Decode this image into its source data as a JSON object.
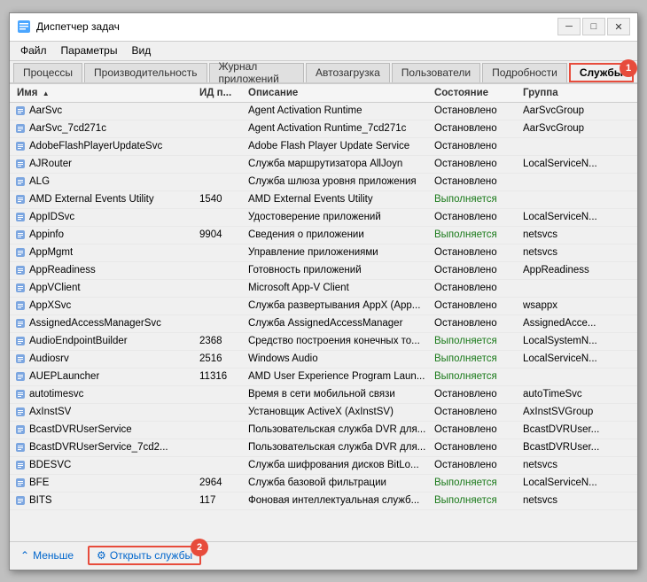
{
  "window": {
    "title": "Диспетчер задач",
    "icon": "⚙"
  },
  "menu": {
    "items": [
      "Файл",
      "Параметры",
      "Вид"
    ]
  },
  "tabs": {
    "items": [
      "Процессы",
      "Производительность",
      "Журнал приложений",
      "Автозагрузка",
      "Пользователи",
      "Подробности",
      "Службы"
    ],
    "active": 6
  },
  "table": {
    "headers": {
      "name": "Имя",
      "pid": "ИД п...",
      "description": "Описание",
      "status": "Состояние",
      "group": "Группа"
    },
    "rows": [
      {
        "name": "AarSvc",
        "pid": "",
        "description": "Agent Activation Runtime",
        "status": "Остановлено",
        "group": "AarSvcGroup",
        "icon": "⚙",
        "running": false
      },
      {
        "name": "AarSvc_7cd271c",
        "pid": "",
        "description": "Agent Activation Runtime_7cd271c",
        "status": "Остановлено",
        "group": "AarSvcGroup",
        "icon": "⚙",
        "running": false
      },
      {
        "name": "AdobeFlashPlayerUpdateSvc",
        "pid": "",
        "description": "Adobe Flash Player Update Service",
        "status": "Остановлено",
        "group": "",
        "icon": "⚙",
        "running": false
      },
      {
        "name": "AJRouter",
        "pid": "",
        "description": "Служба маршрутизатора AllJoyn",
        "status": "Остановлено",
        "group": "LocalServiceN...",
        "icon": "⚙",
        "running": false
      },
      {
        "name": "ALG",
        "pid": "",
        "description": "Служба шлюза уровня приложения",
        "status": "Остановлено",
        "group": "",
        "icon": "⚙",
        "running": false
      },
      {
        "name": "AMD External Events Utility",
        "pid": "1540",
        "description": "AMD External Events Utility",
        "status": "Выполняется",
        "group": "",
        "icon": "⚙",
        "running": true
      },
      {
        "name": "AppIDSvc",
        "pid": "",
        "description": "Удостоверение приложений",
        "status": "Остановлено",
        "group": "LocalServiceN...",
        "icon": "⚙",
        "running": false
      },
      {
        "name": "Appinfo",
        "pid": "9904",
        "description": "Сведения о приложении",
        "status": "Выполняется",
        "group": "netsvcs",
        "icon": "⚙",
        "running": true
      },
      {
        "name": "AppMgmt",
        "pid": "",
        "description": "Управление приложениями",
        "status": "Остановлено",
        "group": "netsvcs",
        "icon": "⚙",
        "running": false
      },
      {
        "name": "AppReadiness",
        "pid": "",
        "description": "Готовность приложений",
        "status": "Остановлено",
        "group": "AppReadiness",
        "icon": "⚙",
        "running": false
      },
      {
        "name": "AppVClient",
        "pid": "",
        "description": "Microsoft App-V Client",
        "status": "Остановлено",
        "group": "",
        "icon": "⚙",
        "running": false
      },
      {
        "name": "AppXSvc",
        "pid": "",
        "description": "Служба развертывания AppX (App...",
        "status": "Остановлено",
        "group": "wsappx",
        "icon": "⚙",
        "running": false
      },
      {
        "name": "AssignedAccessManagerSvc",
        "pid": "",
        "description": "Служба AssignedAccessManager",
        "status": "Остановлено",
        "group": "AssignedAcce...",
        "icon": "⚙",
        "running": false
      },
      {
        "name": "AudioEndpointBuilder",
        "pid": "2368",
        "description": "Средство построения конечных то...",
        "status": "Выполняется",
        "group": "LocalSystemN...",
        "icon": "⚙",
        "running": true
      },
      {
        "name": "Audiosrv",
        "pid": "2516",
        "description": "Windows Audio",
        "status": "Выполняется",
        "group": "LocalServiceN...",
        "icon": "⚙",
        "running": true
      },
      {
        "name": "AUEPLauncher",
        "pid": "11316",
        "description": "AMD User Experience Program Laun...",
        "status": "Выполняется",
        "group": "",
        "icon": "⚙",
        "running": true
      },
      {
        "name": "autotimesvc",
        "pid": "",
        "description": "Время в сети мобильной связи",
        "status": "Остановлено",
        "group": "autoTimeSvc",
        "icon": "⚙",
        "running": false
      },
      {
        "name": "AxInstSV",
        "pid": "",
        "description": "Установщик ActiveX (AxInstSV)",
        "status": "Остановлено",
        "group": "AxInstSVGroup",
        "icon": "⚙",
        "running": false
      },
      {
        "name": "BcastDVRUserService",
        "pid": "",
        "description": "Пользовательская служба DVR для...",
        "status": "Остановлено",
        "group": "BcastDVRUser...",
        "icon": "⚙",
        "running": false
      },
      {
        "name": "BcastDVRUserService_7cd2...",
        "pid": "",
        "description": "Пользовательская служба DVR для...",
        "status": "Остановлено",
        "group": "BcastDVRUser...",
        "icon": "⚙",
        "running": false
      },
      {
        "name": "BDESVC",
        "pid": "",
        "description": "Служба шифрования дисков BitLo...",
        "status": "Остановлено",
        "group": "netsvcs",
        "icon": "⚙",
        "running": false
      },
      {
        "name": "BFE",
        "pid": "2964",
        "description": "Служба базовой фильтрации",
        "status": "Выполняется",
        "group": "LocalServiceN...",
        "icon": "⚙",
        "running": true
      },
      {
        "name": "BITS",
        "pid": "117",
        "description": "Фоновая интеллектуальная служб...",
        "status": "Выполняется",
        "group": "netsvcs",
        "icon": "⚙",
        "running": true
      }
    ]
  },
  "bottom": {
    "less_label": "Меньше",
    "open_services_label": "Открыть службы",
    "badge_1": "1",
    "badge_2": "2"
  }
}
